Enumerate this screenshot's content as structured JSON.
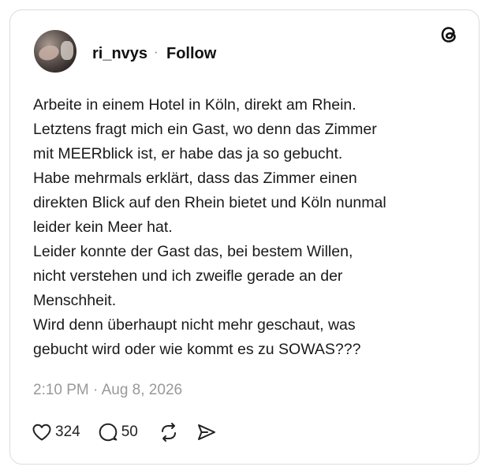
{
  "post": {
    "username": "ri_nvys",
    "separator": "·",
    "follow_label": "Follow",
    "text": "Arbeite in einem Hotel in Köln, direkt am Rhein.\nLetztens fragt mich ein Gast, wo denn das Zimmer\nmit MEERblick ist, er habe das ja so gebucht.\nHabe mehrmals erklärt, dass das Zimmer einen\ndirekten Blick auf den Rhein bietet und Köln nunmal\nleider kein Meer hat.\nLeider konnte der Gast das, bei bestem Willen,\nnicht verstehen und ich zweifle gerade an der\nMenschheit.\nWird denn überhaupt nicht mehr geschaut, was\ngebucht wird oder wie kommt es zu SOWAS???",
    "timestamp": "2:10 PM · Aug 8, 2026"
  },
  "actions": {
    "likes": "324",
    "replies": "50",
    "icons": [
      "heart-icon",
      "comment-icon",
      "repost-icon",
      "share-icon"
    ]
  },
  "logo": "threads-logo-icon"
}
